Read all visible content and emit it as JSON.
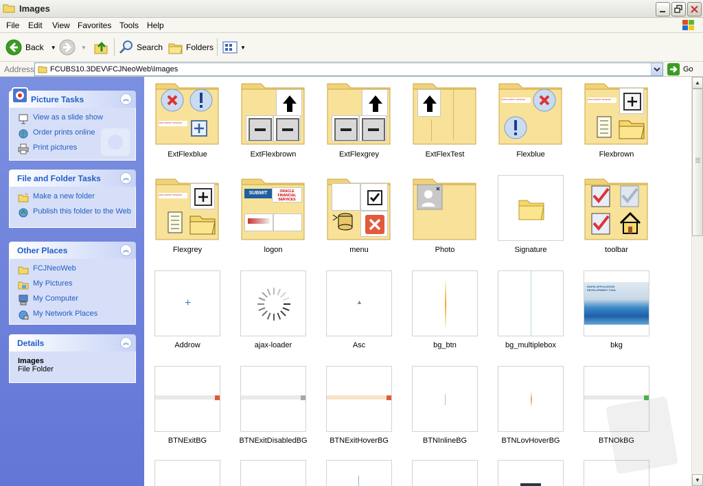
{
  "window": {
    "title": "Images"
  },
  "menu": [
    "File",
    "Edit",
    "View",
    "Favorites",
    "Tools",
    "Help"
  ],
  "toolbar": {
    "back": "Back",
    "search": "Search",
    "folders": "Folders"
  },
  "address": {
    "label": "Address",
    "path": "FCUBS10.3DEV\\FCJNeoWeb\\Images",
    "go": "Go"
  },
  "left_pane": {
    "picture_tasks": {
      "title": "Picture Tasks",
      "items": [
        "View as a slide show",
        "Order prints online",
        "Print pictures"
      ]
    },
    "file_folder_tasks": {
      "title": "File and Folder Tasks",
      "items": [
        "Make a new folder",
        "Publish this folder to the Web"
      ]
    },
    "other_places": {
      "title": "Other Places",
      "items": [
        "FCJNeoWeb",
        "My Pictures",
        "My Computer",
        "My Network Places"
      ]
    },
    "details": {
      "title": "Details",
      "name": "Images",
      "type": "File Folder"
    }
  },
  "items": [
    {
      "label": "ExtFlexblue",
      "kind": "folder"
    },
    {
      "label": "ExtFlexbrown",
      "kind": "folder"
    },
    {
      "label": "ExtFlexgrey",
      "kind": "folder"
    },
    {
      "label": "ExtFlexTest",
      "kind": "folder"
    },
    {
      "label": "Flexblue",
      "kind": "folder"
    },
    {
      "label": "Flexbrown",
      "kind": "folder"
    },
    {
      "label": "Flexgrey",
      "kind": "folder"
    },
    {
      "label": "logon",
      "kind": "folder"
    },
    {
      "label": "menu",
      "kind": "folder"
    },
    {
      "label": "Photo",
      "kind": "folder"
    },
    {
      "label": "Signature",
      "kind": "folder"
    },
    {
      "label": "toolbar",
      "kind": "folder"
    },
    {
      "label": "Addrow",
      "kind": "image"
    },
    {
      "label": "ajax-loader",
      "kind": "image"
    },
    {
      "label": "Asc",
      "kind": "image"
    },
    {
      "label": "bg_btn",
      "kind": "image"
    },
    {
      "label": "bg_multiplebox",
      "kind": "image"
    },
    {
      "label": "bkg",
      "kind": "image"
    },
    {
      "label": "BTNExitBG",
      "kind": "image"
    },
    {
      "label": "BTNExitDisabledBG",
      "kind": "image"
    },
    {
      "label": "BTNExitHoverBG",
      "kind": "image"
    },
    {
      "label": "BTNInlineBG",
      "kind": "image"
    },
    {
      "label": "BTNLovHoverBG",
      "kind": "image"
    },
    {
      "label": "BTNOkBG",
      "kind": "image"
    }
  ],
  "scroll": {
    "position": 0.0
  }
}
